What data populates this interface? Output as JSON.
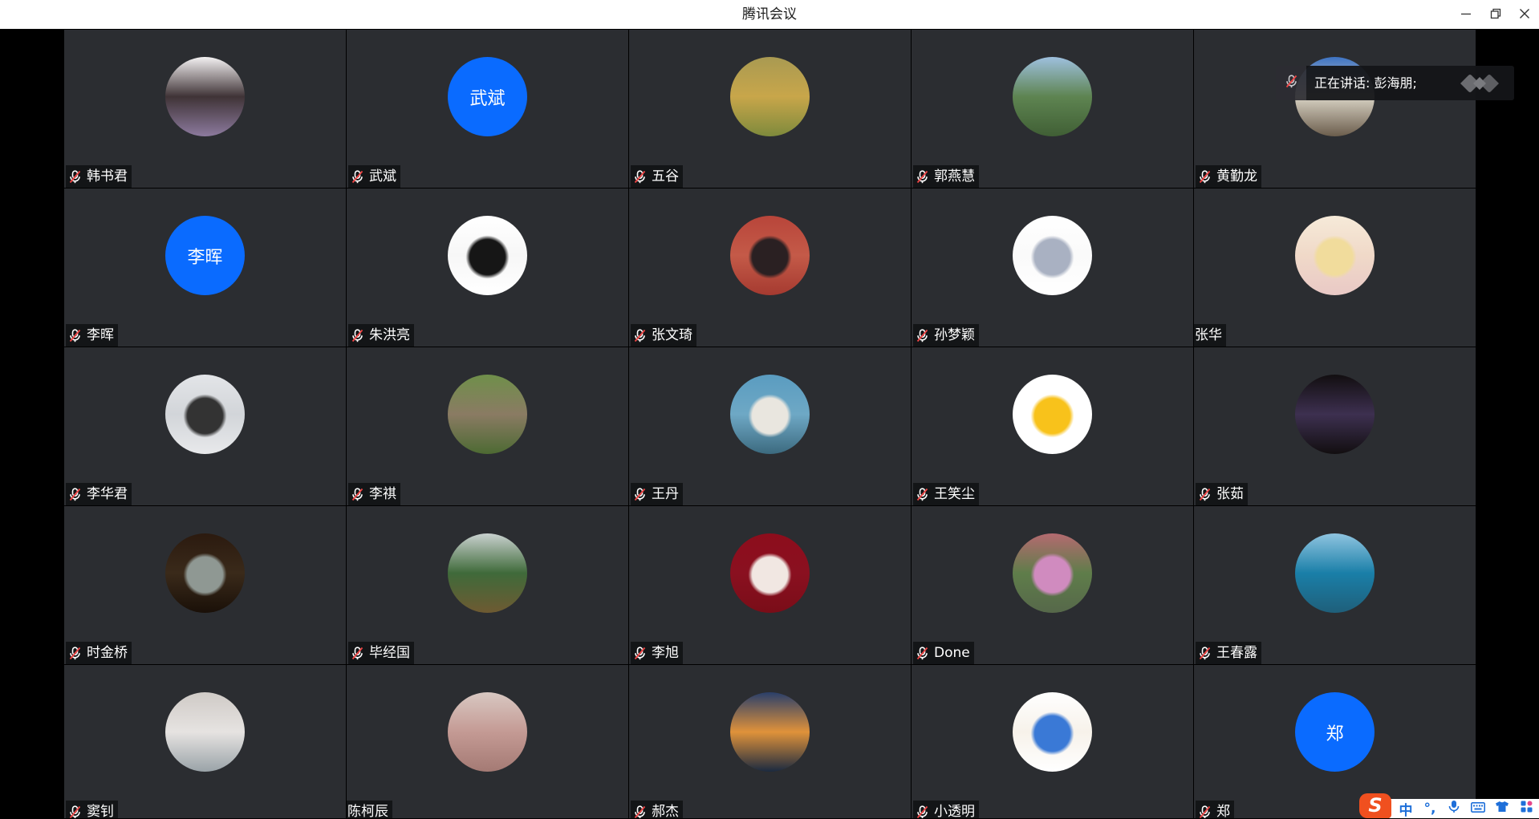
{
  "window": {
    "title": "腾讯会议",
    "minimize_icon": "minimize-icon",
    "restore_icon": "restore-icon",
    "close_icon": "close-icon"
  },
  "colors": {
    "tile_bg": "#2b2d31",
    "avatar_blue": "#0a6bff",
    "mute_red": "#f04545",
    "ime_accent": "#1e6fd9",
    "ime_logo": "#f0501f"
  },
  "speaking_banner": {
    "text": "正在讲话: 彭海朋;",
    "icon": "mic-off-icon",
    "logo": "tencent-meeting-logo-icon"
  },
  "participants": [
    {
      "name": "韩书君",
      "status_icon": "mic-off-icon",
      "photo": [
        "#f3f1f2",
        "#3f3336",
        "#8c7a9e"
      ]
    },
    {
      "name": "武斌",
      "status_icon": "mic-off-icon",
      "initials": "武斌"
    },
    {
      "name": "五谷",
      "status_icon": "mic-off-icon",
      "photo": [
        "#a99a52",
        "#c8a64a",
        "#7e8a3c"
      ]
    },
    {
      "name": "郭燕慧",
      "status_icon": "mic-off-icon",
      "photo": [
        "#9ec0de",
        "#5e8451",
        "#405f35"
      ]
    },
    {
      "name": "黄勤龙",
      "status_icon": "mic-off-icon",
      "photo": [
        "#3d73c4",
        "#d8d2c4",
        "#6b5d4c"
      ]
    },
    {
      "name": "李晖",
      "status_icon": "mic-off-icon",
      "initials": "李晖"
    },
    {
      "name": "朱洪亮",
      "status_icon": "mic-off-icon",
      "photo": [
        "#ffffff",
        "#f7f7f7",
        "#ffffff"
      ],
      "spot": "#161616"
    },
    {
      "name": "张文琦",
      "status_icon": "mic-off-icon",
      "photo": [
        "#b8453a",
        "#c45a48",
        "#a53a30"
      ],
      "spot": "#2a2022"
    },
    {
      "name": "孙梦颖",
      "status_icon": "mic-off-icon",
      "photo": [
        "#ffffff",
        "#fafafa",
        "#ffffff"
      ],
      "spot": "#a9b1c2"
    },
    {
      "name": "张华",
      "photo": [
        "#f6ead9",
        "#f0d9c8",
        "#e9c9c6"
      ],
      "spot": "#f1dc9c"
    },
    {
      "name": "李华君",
      "status_icon": "mic-off-icon",
      "photo": [
        "#e3e5e8",
        "#d2d5d9",
        "#e8e9eb"
      ],
      "spot": "#333333"
    },
    {
      "name": "李祺",
      "status_icon": "mic-off-icon",
      "photo": [
        "#6f8f4a",
        "#8a7b63",
        "#4d6a33"
      ]
    },
    {
      "name": "王丹",
      "status_icon": "mic-off-icon",
      "photo": [
        "#5a9cc0",
        "#6ea8c5",
        "#3c6a7f"
      ],
      "spot": "#e9e6df"
    },
    {
      "name": "王笑尘",
      "status_icon": "mic-off-icon",
      "photo": [
        "#ffffff",
        "#ffffff",
        "#ffffff"
      ],
      "spot": "#f8c21b"
    },
    {
      "name": "张茹",
      "status_icon": "mic-off-icon",
      "photo": [
        "#120e10",
        "#3d3050",
        "#120e10"
      ]
    },
    {
      "name": "时金桥",
      "status_icon": "mic-off-icon",
      "photo": [
        "#2b1a0f",
        "#3a2a1a",
        "#1a1008"
      ],
      "spot": "#8f9893"
    },
    {
      "name": "毕经国",
      "status_icon": "mic-off-icon",
      "photo": [
        "#c9d1cf",
        "#3f6a3a",
        "#6e5a32"
      ]
    },
    {
      "name": "李旭",
      "status_icon": "mic-off-icon",
      "photo": [
        "#8d0d1c",
        "#8a1020",
        "#7a0d18"
      ],
      "spot": "#f1e7e2"
    },
    {
      "name": "Done",
      "status_icon": "mic-off-icon",
      "photo": [
        "#b46a70",
        "#5f7d4a",
        "#56684a"
      ],
      "spot": "#d08bbf"
    },
    {
      "name": "王春露",
      "status_icon": "mic-off-icon",
      "photo": [
        "#8fc4e0",
        "#1a7fa8",
        "#1f5f7a"
      ]
    },
    {
      "name": "窦钊",
      "status_icon": "mic-off-icon",
      "photo": [
        "#cfcac6",
        "#e6e3e1",
        "#9aa3a8"
      ]
    },
    {
      "name": "陈柯辰",
      "photo": [
        "#d8c8c2",
        "#c49a94",
        "#a47a74"
      ]
    },
    {
      "name": "郝杰",
      "status_icon": "mic-off-icon",
      "photo": [
        "#2a3f6a",
        "#e0923a",
        "#1b2a40"
      ]
    },
    {
      "name": "小透明",
      "status_icon": "mic-off-icon",
      "photo": [
        "#ffffff",
        "#f7f2ea",
        "#ffffff"
      ],
      "spot": "#3a79d6"
    },
    {
      "name": "郑",
      "status_icon": "mic-off-icon",
      "initials": "郑"
    }
  ],
  "ime_toolbar": {
    "logo": "S",
    "mode": "中",
    "punctuation": "°,",
    "voice_icon": "voice-input-icon",
    "keyboard_icon": "soft-keyboard-icon",
    "skin_icon": "skin-icon",
    "toolbox_icon": "toolbox-icon"
  }
}
